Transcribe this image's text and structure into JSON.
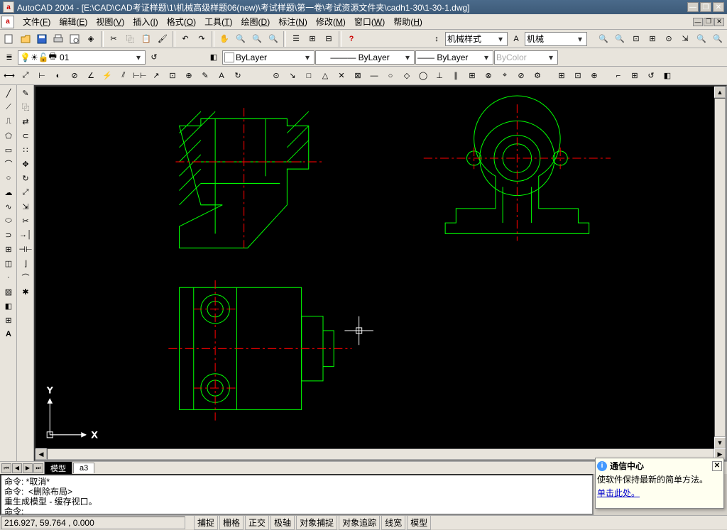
{
  "title": "AutoCAD 2004 - [E:\\CAD\\CAD考证样题\\1\\机械高级样题06(new)\\考试样题\\第一卷\\考试资源文件夹\\cadh1-30\\1-30-1.dwg]",
  "app_icon_letter": "a",
  "menu": [
    {
      "label": "文件",
      "mn": "F"
    },
    {
      "label": "编辑",
      "mn": "E"
    },
    {
      "label": "视图",
      "mn": "V"
    },
    {
      "label": "插入",
      "mn": "I"
    },
    {
      "label": "格式",
      "mn": "O"
    },
    {
      "label": "工具",
      "mn": "T"
    },
    {
      "label": "绘图",
      "mn": "D"
    },
    {
      "label": "标注",
      "mn": "N"
    },
    {
      "label": "修改",
      "mn": "M"
    },
    {
      "label": "窗口",
      "mn": "W"
    },
    {
      "label": "帮助",
      "mn": "H"
    }
  ],
  "layer": {
    "current": "01"
  },
  "color": {
    "label": "ByLayer",
    "swatch": "#ffffff"
  },
  "linetype": {
    "label": "ByLayer"
  },
  "lineweight": {
    "label": "ByLayer"
  },
  "plotstyle": {
    "label": "ByColor"
  },
  "dimstyle": {
    "label": "机械样式"
  },
  "textstyle": {
    "label": "机械"
  },
  "tabs": {
    "active": "模型",
    "layouts": [
      "a3"
    ]
  },
  "command_history": [
    "命令: *取消*",
    "命令:  <删除布局>",
    "重生成模型 - 缓存视口。"
  ],
  "command_prompt": "命令:",
  "coords": "216.927, 59.764 , 0.000",
  "status_buttons": [
    "捕捉",
    "栅格",
    "正交",
    "极轴",
    "对象捕捉",
    "对象追踪",
    "线宽",
    "模型"
  ],
  "comm_center": {
    "title": "通信中心",
    "body": "使软件保持最新的简单方法。",
    "link": "单击此处。"
  },
  "ucs": {
    "x": "X",
    "y": "Y"
  }
}
